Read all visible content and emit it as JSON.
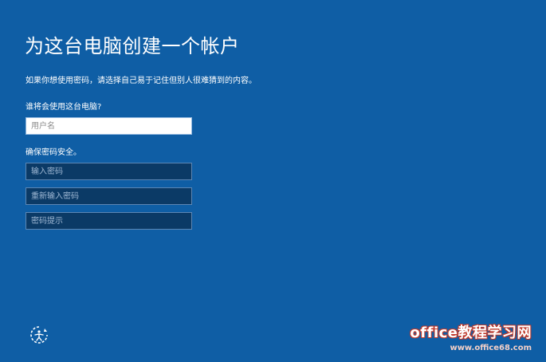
{
  "page": {
    "title": "为这台电脑创建一个帐户",
    "subtitle": "如果你想使用密码，请选择自己易于记住但别人很难猜到的内容。"
  },
  "account": {
    "who_label": "谁将会使用这台电脑?",
    "username_placeholder": "用户名"
  },
  "password": {
    "section_label": "确保密码安全。",
    "enter_placeholder": "输入密码",
    "reenter_placeholder": "重新输入密码",
    "hint_placeholder": "密码提示"
  },
  "footer": {
    "ease_of_access_icon": "ease-of-access-icon"
  },
  "watermark": {
    "main": "office教程学习网",
    "url": "www.office68.com"
  },
  "colors": {
    "background": "#0f5ea5",
    "dark_field": "#0b3a66",
    "watermark_outline": "#c0392b"
  }
}
